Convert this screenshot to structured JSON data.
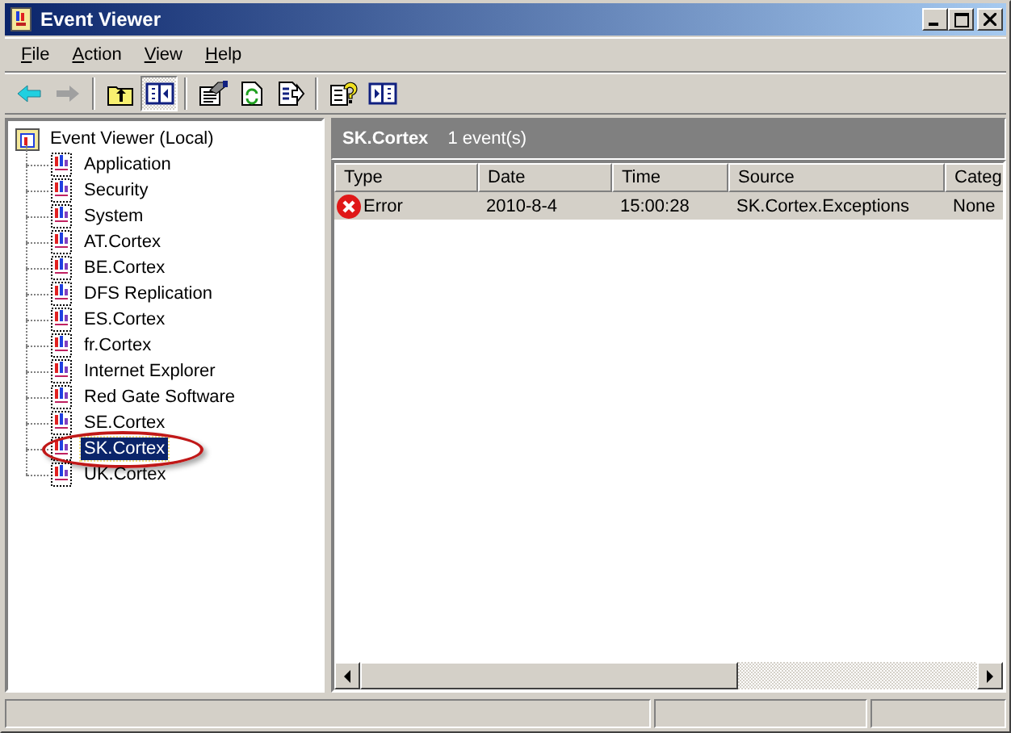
{
  "window": {
    "title": "Event Viewer"
  },
  "menu": [
    "File",
    "Action",
    "View",
    "Help"
  ],
  "toolbar": [
    {
      "kind": "back",
      "disabled": false,
      "pressed": false
    },
    {
      "kind": "forward",
      "disabled": true,
      "pressed": false
    },
    {
      "kind": "separator"
    },
    {
      "kind": "up",
      "pressed": false
    },
    {
      "kind": "tree",
      "pressed": true
    },
    {
      "kind": "separator"
    },
    {
      "kind": "properties",
      "pressed": false
    },
    {
      "kind": "refresh",
      "pressed": false
    },
    {
      "kind": "export",
      "pressed": false
    },
    {
      "kind": "separator"
    },
    {
      "kind": "help",
      "pressed": false
    },
    {
      "kind": "console",
      "pressed": false
    }
  ],
  "tree": {
    "label": "Event Viewer (Local)",
    "children": [
      {
        "label": "Application",
        "selected": false
      },
      {
        "label": "Security",
        "selected": false
      },
      {
        "label": "System",
        "selected": false
      },
      {
        "label": "AT.Cortex",
        "selected": false
      },
      {
        "label": "BE.Cortex",
        "selected": false
      },
      {
        "label": "DFS Replication",
        "selected": false
      },
      {
        "label": "ES.Cortex",
        "selected": false
      },
      {
        "label": "fr.Cortex",
        "selected": false
      },
      {
        "label": "Internet Explorer",
        "selected": false
      },
      {
        "label": "Red Gate Software",
        "selected": false
      },
      {
        "label": "SE.Cortex",
        "selected": false
      },
      {
        "label": "SK.Cortex",
        "selected": true,
        "circled": true
      },
      {
        "label": "UK.Cortex",
        "selected": false
      }
    ]
  },
  "pane": {
    "title": "SK.Cortex",
    "count": "1 event(s)"
  },
  "table": {
    "columns": [
      "Type",
      "Date",
      "Time",
      "Source",
      "Categ"
    ],
    "rows": [
      {
        "kind": "error",
        "selected": true,
        "cells": [
          "Error",
          "2010-8-4",
          "15:00:28",
          "SK.Cortex.Exceptions",
          "None"
        ]
      }
    ]
  }
}
